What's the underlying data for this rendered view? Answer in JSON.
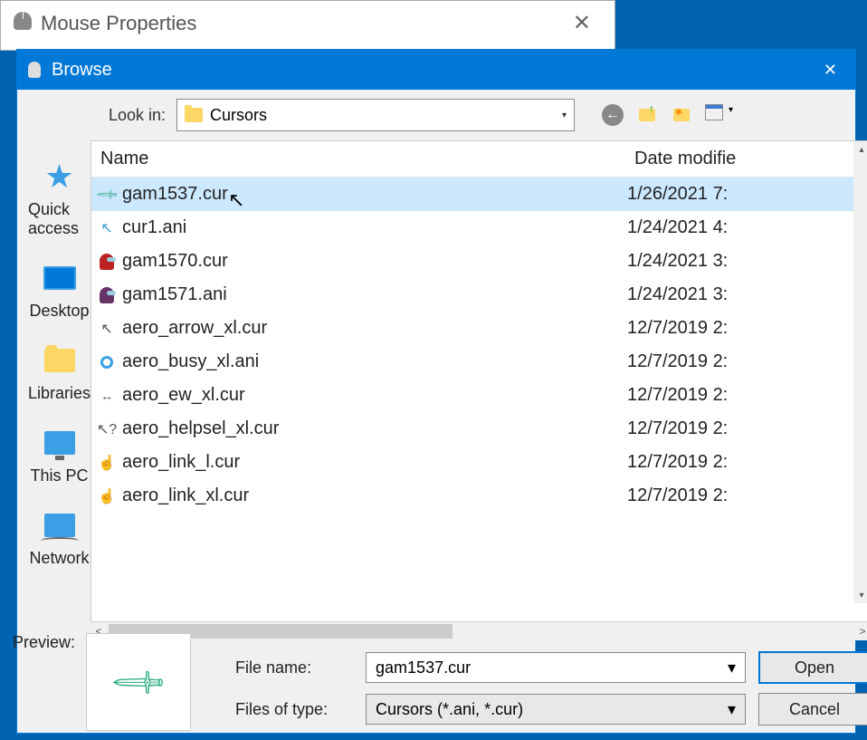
{
  "parent_window": {
    "title": "Mouse Properties"
  },
  "dialog": {
    "title": "Browse",
    "lookin_label": "Look in:",
    "lookin_value": "Cursors",
    "places": [
      {
        "label": "Quick access",
        "icon": "star"
      },
      {
        "label": "Desktop",
        "icon": "desktop"
      },
      {
        "label": "Libraries",
        "icon": "libraries"
      },
      {
        "label": "This PC",
        "icon": "pc"
      },
      {
        "label": "Network",
        "icon": "network"
      }
    ],
    "columns": {
      "name": "Name",
      "date": "Date modifie"
    },
    "files": [
      {
        "name": "gam1537.cur",
        "date": "1/26/2021 7:",
        "icon": "sword",
        "selected": true
      },
      {
        "name": "cur1.ani",
        "date": "1/24/2021 4:",
        "icon": "arrow"
      },
      {
        "name": "gam1570.cur",
        "date": "1/24/2021 3:",
        "icon": "among-r"
      },
      {
        "name": "gam1571.ani",
        "date": "1/24/2021 3:",
        "icon": "among-p"
      },
      {
        "name": "aero_arrow_xl.cur",
        "date": "12/7/2019 2:",
        "icon": "cursor"
      },
      {
        "name": "aero_busy_xl.ani",
        "date": "12/7/2019 2:",
        "icon": "busy"
      },
      {
        "name": "aero_ew_xl.cur",
        "date": "12/7/2019 2:",
        "icon": "ew"
      },
      {
        "name": "aero_helpsel_xl.cur",
        "date": "12/7/2019 2:",
        "icon": "help"
      },
      {
        "name": "aero_link_l.cur",
        "date": "12/7/2019 2:",
        "icon": "link"
      },
      {
        "name": "aero_link_xl.cur",
        "date": "12/7/2019 2:",
        "icon": "link"
      }
    ],
    "filename_label": "File name:",
    "filename_value": "gam1537.cur",
    "filetype_label": "Files of type:",
    "filetype_value": "Cursors (*.ani, *.cur)",
    "open_label": "Open",
    "cancel_label": "Cancel",
    "preview_label": "Preview:"
  }
}
